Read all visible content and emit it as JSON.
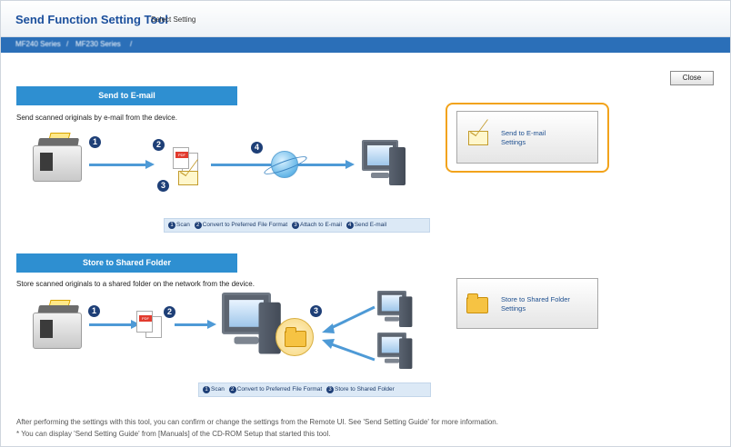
{
  "app": {
    "title": "Send Function Setting Tool",
    "subtitle": "Select Setting",
    "breadcrumb": [
      "MF240 Series",
      "/",
      "MF230 Series",
      "/"
    ]
  },
  "close_label": "Close",
  "email_section": {
    "banner": "Send to E-mail",
    "description": "Send scanned originals by e-mail from the device.",
    "step_numbers": [
      "1",
      "2",
      "3",
      "4"
    ],
    "pdf_label": "PDF",
    "legend": [
      {
        "num": "1",
        "text": "Scan"
      },
      {
        "num": "2",
        "text": "Convert to Preferred File Format"
      },
      {
        "num": "3",
        "text": "Attach to E-mail"
      },
      {
        "num": "4",
        "text": "Send E-mail"
      }
    ],
    "button_lines": [
      "Send to E-mail",
      "Settings"
    ]
  },
  "folder_section": {
    "banner": "Store to Shared Folder",
    "description": "Store scanned originals to a shared folder on the network from the device.",
    "step_numbers": [
      "1",
      "2",
      "3"
    ],
    "pdf_label": "PDF",
    "legend": [
      {
        "num": "1",
        "text": "Scan"
      },
      {
        "num": "2",
        "text": "Convert to Preferred File Format"
      },
      {
        "num": "3",
        "text": "Store to Shared Folder"
      }
    ],
    "button_lines": [
      "Store to Shared Folder",
      "Settings"
    ]
  },
  "footer": {
    "line1": "After performing the settings with this tool, you can confirm or change the settings from the Remote UI. See 'Send Setting Guide' for more information.",
    "line2": "* You can display 'Send Setting Guide' from [Manuals] of the CD-ROM Setup that started this tool."
  },
  "colors": {
    "brand_blue": "#1b4f9c",
    "breadcrumb_bar": "#2b6fb8",
    "banner_blue": "#2e8fd1",
    "highlight_orange": "#f2a31b"
  }
}
